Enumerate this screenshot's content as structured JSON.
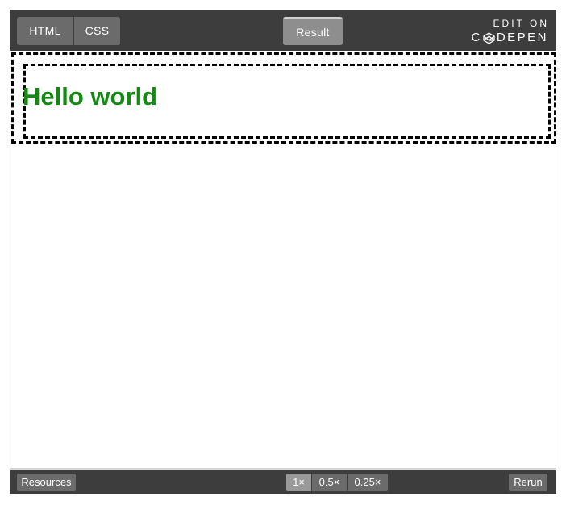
{
  "tabs": {
    "html": "HTML",
    "css": "CSS",
    "result": "Result"
  },
  "brand": {
    "line1": "EDIT ON",
    "pre": "C",
    "post": "DEPEN"
  },
  "result": {
    "heading": "Hello world",
    "heading_color": "#148a14"
  },
  "footer": {
    "resources": "Resources",
    "zoom": [
      "1×",
      "0.5×",
      "0.25×"
    ],
    "zoom_selected": "1×",
    "rerun": "Rerun"
  },
  "colors": {
    "bar": "#3d3d3e",
    "button": "#6b6b6c",
    "active_tab": "#8e8e8f"
  }
}
